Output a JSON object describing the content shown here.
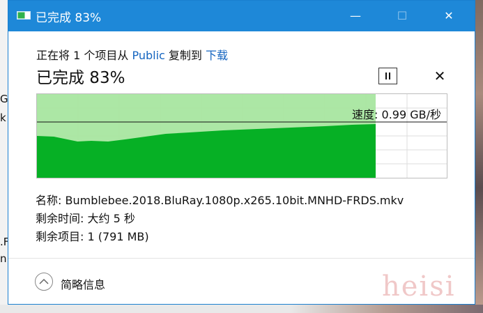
{
  "window": {
    "title": "已完成 83%",
    "minimize_label": "—",
    "maximize_label": "☐",
    "close_label": "✕"
  },
  "copy": {
    "prefix": "正在将 1 个项目从 ",
    "source": "Public",
    "middle": " 复制到 ",
    "destination": "下载",
    "status": "已完成 83%",
    "progress_percent": 83,
    "cancel_label": "✕"
  },
  "graph": {
    "speed_label": "速度: 0.99 GB/秒"
  },
  "details": {
    "name_label": "名称: ",
    "name_value": "Bumblebee.2018.BluRay.1080p.x265.10bit.MNHD-FRDS.mkv",
    "time_label": "剩余时间: ",
    "time_value": "大约 5 秒",
    "items_label": "剩余项目: ",
    "items_value": "1 (791 MB)"
  },
  "footer": {
    "toggle_label": "简略信息"
  },
  "background": {
    "frag1": "G",
    "frag2": "k",
    "frag3": ".F",
    "frag4": "n",
    "watermark": "heisi"
  },
  "colors": {
    "titlebar": "#1e88d8",
    "progress_fill": "#06b025",
    "progress_bg": "#a8e6a0",
    "link": "#1565c0"
  },
  "icons": {
    "app": "copy-progress-icon",
    "pause": "pause-icon",
    "cancel": "close-icon",
    "toggle": "chevron-up-icon"
  }
}
